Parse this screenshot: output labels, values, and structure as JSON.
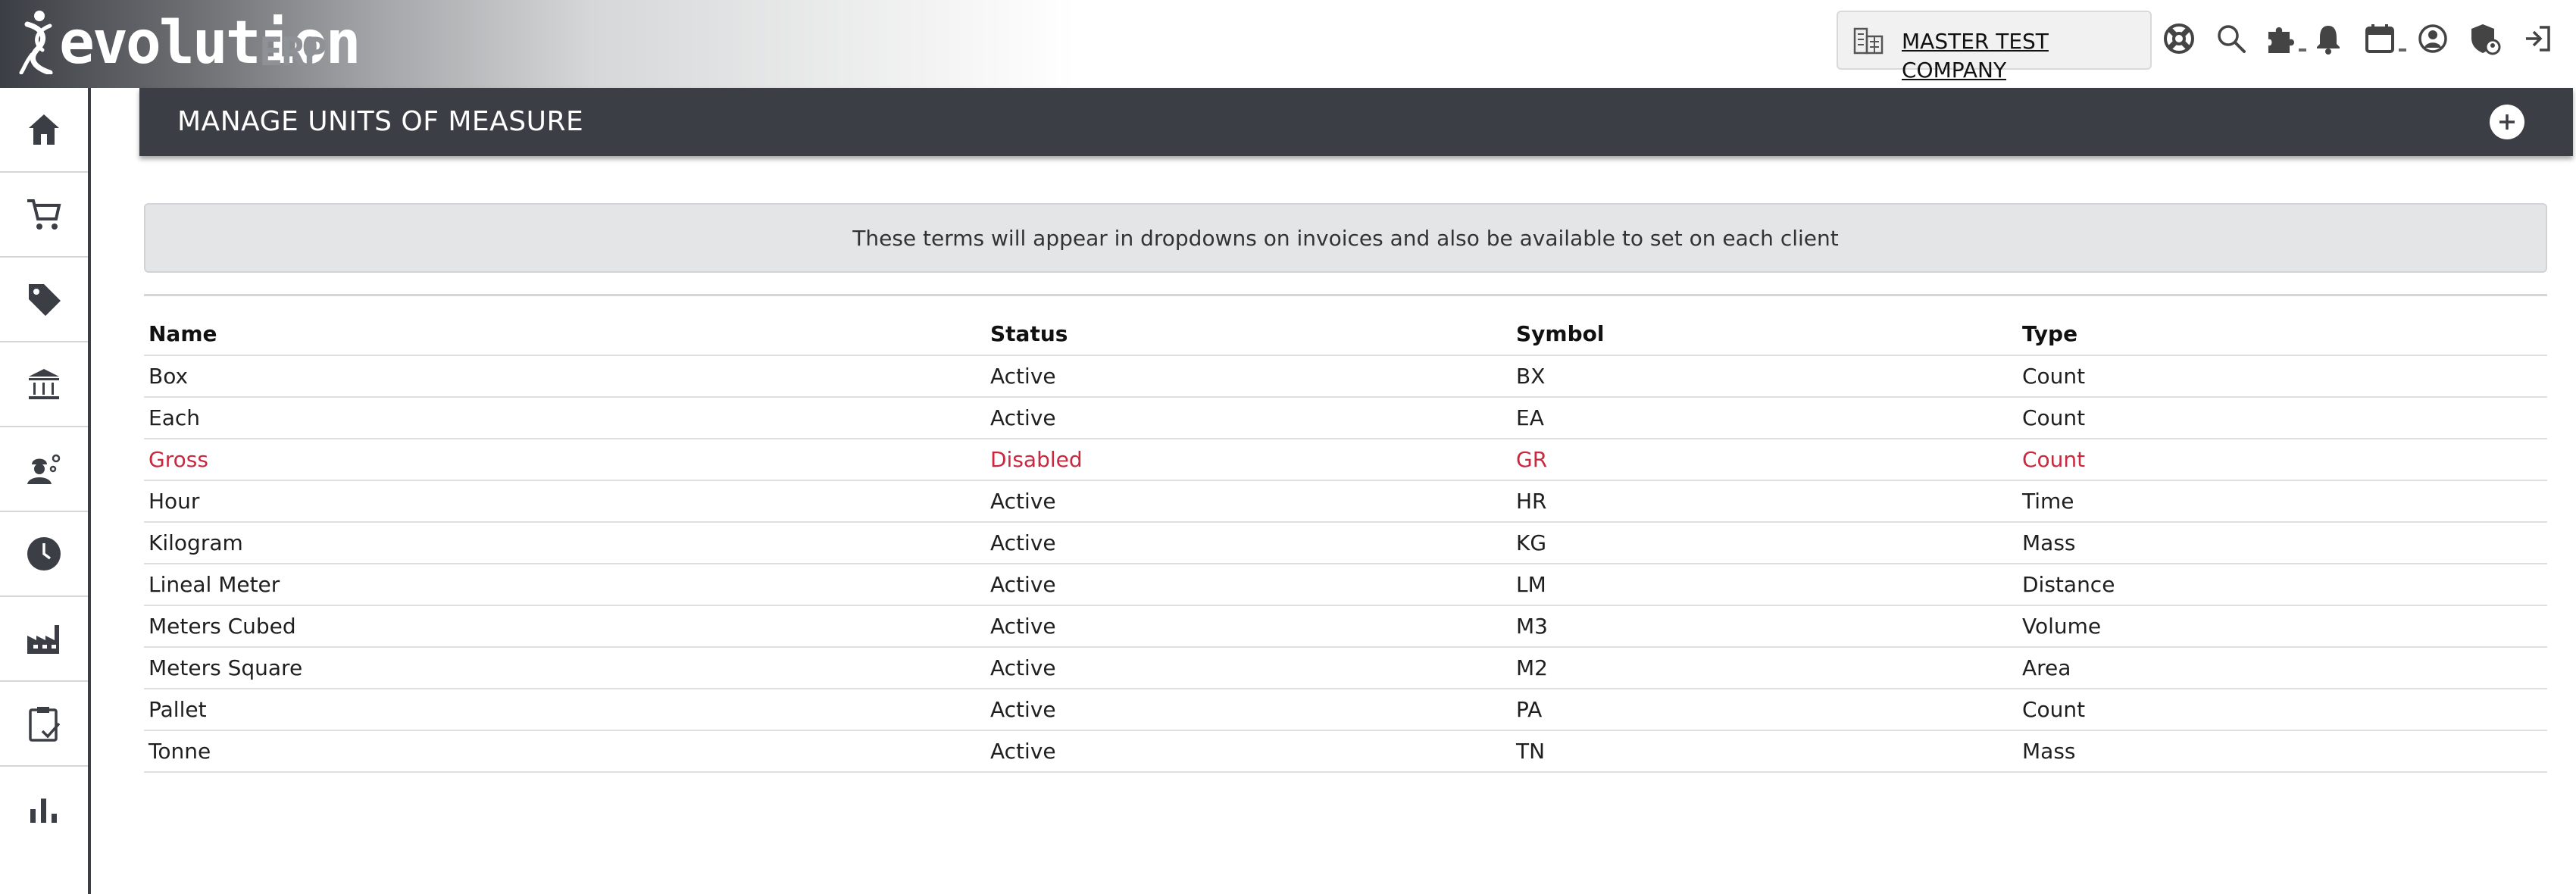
{
  "app": {
    "logo_text": "evolution",
    "logo_suffix": "ERP",
    "company_name": "MASTER TEST COMPANY"
  },
  "top_icons": [
    "support-icon",
    "search-icon",
    "puzzle-icon",
    "bell-icon",
    "calendar-icon",
    "user-circle-icon",
    "shield-user-icon",
    "logout-icon"
  ],
  "sidebar": {
    "items": [
      "home-icon",
      "cart-icon",
      "tag-icon",
      "bank-icon",
      "worker-icon",
      "clock-icon",
      "factory-icon",
      "clipboard-check-icon",
      "bar-chart-icon"
    ]
  },
  "page": {
    "title": "MANAGE UNITS OF MEASURE",
    "notice": "These terms will appear in dropdowns on invoices and also be available to set on each client"
  },
  "table": {
    "headers": {
      "name": "Name",
      "status": "Status",
      "symbol": "Symbol",
      "type": "Type"
    },
    "rows": [
      {
        "name": "Box",
        "status": "Active",
        "symbol": "BX",
        "type": "Count"
      },
      {
        "name": "Each",
        "status": "Active",
        "symbol": "EA",
        "type": "Count"
      },
      {
        "name": "Gross",
        "status": "Disabled",
        "symbol": "GR",
        "type": "Count"
      },
      {
        "name": "Hour",
        "status": "Active",
        "symbol": "HR",
        "type": "Time"
      },
      {
        "name": "Kilogram",
        "status": "Active",
        "symbol": "KG",
        "type": "Mass"
      },
      {
        "name": "Lineal Meter",
        "status": "Active",
        "symbol": "LM",
        "type": "Distance"
      },
      {
        "name": "Meters Cubed",
        "status": "Active",
        "symbol": "M3",
        "type": "Volume"
      },
      {
        "name": "Meters Square",
        "status": "Active",
        "symbol": "M2",
        "type": "Area"
      },
      {
        "name": "Pallet",
        "status": "Active",
        "symbol": "PA",
        "type": "Count"
      },
      {
        "name": "Tonne",
        "status": "Active",
        "symbol": "TN",
        "type": "Mass"
      }
    ]
  },
  "colors": {
    "header_bg": "#3b3e44",
    "disabled_text": "#c9283e",
    "notice_bg": "#e4e5e7"
  }
}
